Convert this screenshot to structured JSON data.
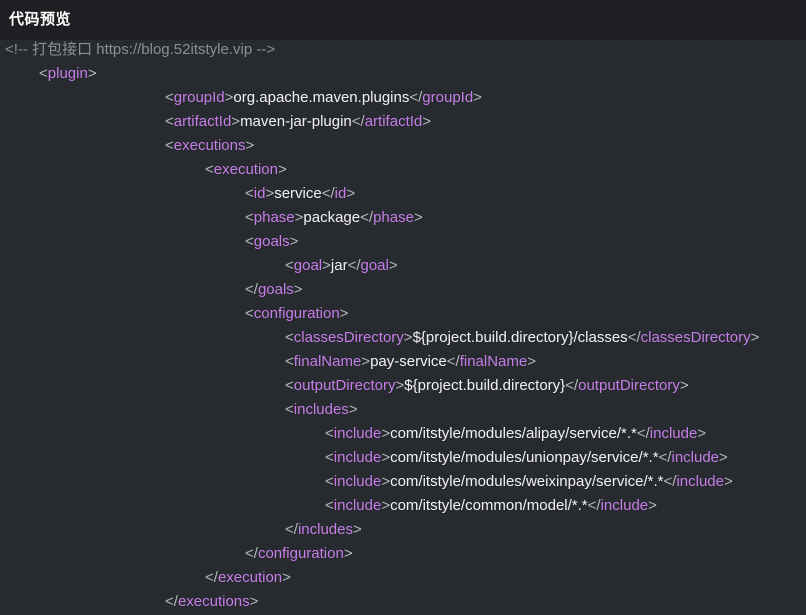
{
  "header": {
    "title": "代码预览"
  },
  "code": {
    "lines": [
      {
        "indent": 5,
        "kind": "comment",
        "text": "<!-- 打包接口 https://blog.52itstyle.vip -->"
      },
      {
        "indent": 39,
        "kind": "open",
        "tag": "plugin"
      },
      {
        "indent": 165,
        "kind": "elem",
        "tag": "groupId",
        "value": "org.apache.maven.plugins"
      },
      {
        "indent": 165,
        "kind": "elem",
        "tag": "artifactId",
        "value": "maven-jar-plugin"
      },
      {
        "indent": 165,
        "kind": "open",
        "tag": "executions"
      },
      {
        "indent": 205,
        "kind": "open",
        "tag": "execution"
      },
      {
        "indent": 245,
        "kind": "elem",
        "tag": "id",
        "value": "service"
      },
      {
        "indent": 245,
        "kind": "elem",
        "tag": "phase",
        "value": "package"
      },
      {
        "indent": 245,
        "kind": "open",
        "tag": "goals"
      },
      {
        "indent": 285,
        "kind": "elem",
        "tag": "goal",
        "value": "jar"
      },
      {
        "indent": 245,
        "kind": "close",
        "tag": "goals"
      },
      {
        "indent": 245,
        "kind": "open",
        "tag": "configuration"
      },
      {
        "indent": 285,
        "kind": "elem",
        "tag": "classesDirectory",
        "value": "${project.build.directory}/classes"
      },
      {
        "indent": 285,
        "kind": "elem",
        "tag": "finalName",
        "value": "pay-service"
      },
      {
        "indent": 285,
        "kind": "elem",
        "tag": "outputDirectory",
        "value": "${project.build.directory}"
      },
      {
        "indent": 285,
        "kind": "open",
        "tag": "includes"
      },
      {
        "indent": 325,
        "kind": "elem",
        "tag": "include",
        "value": "com/itstyle/modules/alipay/service/*.*"
      },
      {
        "indent": 325,
        "kind": "elem",
        "tag": "include",
        "value": "com/itstyle/modules/unionpay/service/*.*"
      },
      {
        "indent": 325,
        "kind": "elem",
        "tag": "include",
        "value": "com/itstyle/modules/weixinpay/service/*.*"
      },
      {
        "indent": 325,
        "kind": "elem",
        "tag": "include",
        "value": "com/itstyle/common/model/*.*"
      },
      {
        "indent": 285,
        "kind": "close",
        "tag": "includes"
      },
      {
        "indent": 245,
        "kind": "close",
        "tag": "configuration"
      },
      {
        "indent": 205,
        "kind": "close",
        "tag": "execution"
      },
      {
        "indent": 165,
        "kind": "close",
        "tag": "executions"
      }
    ]
  }
}
